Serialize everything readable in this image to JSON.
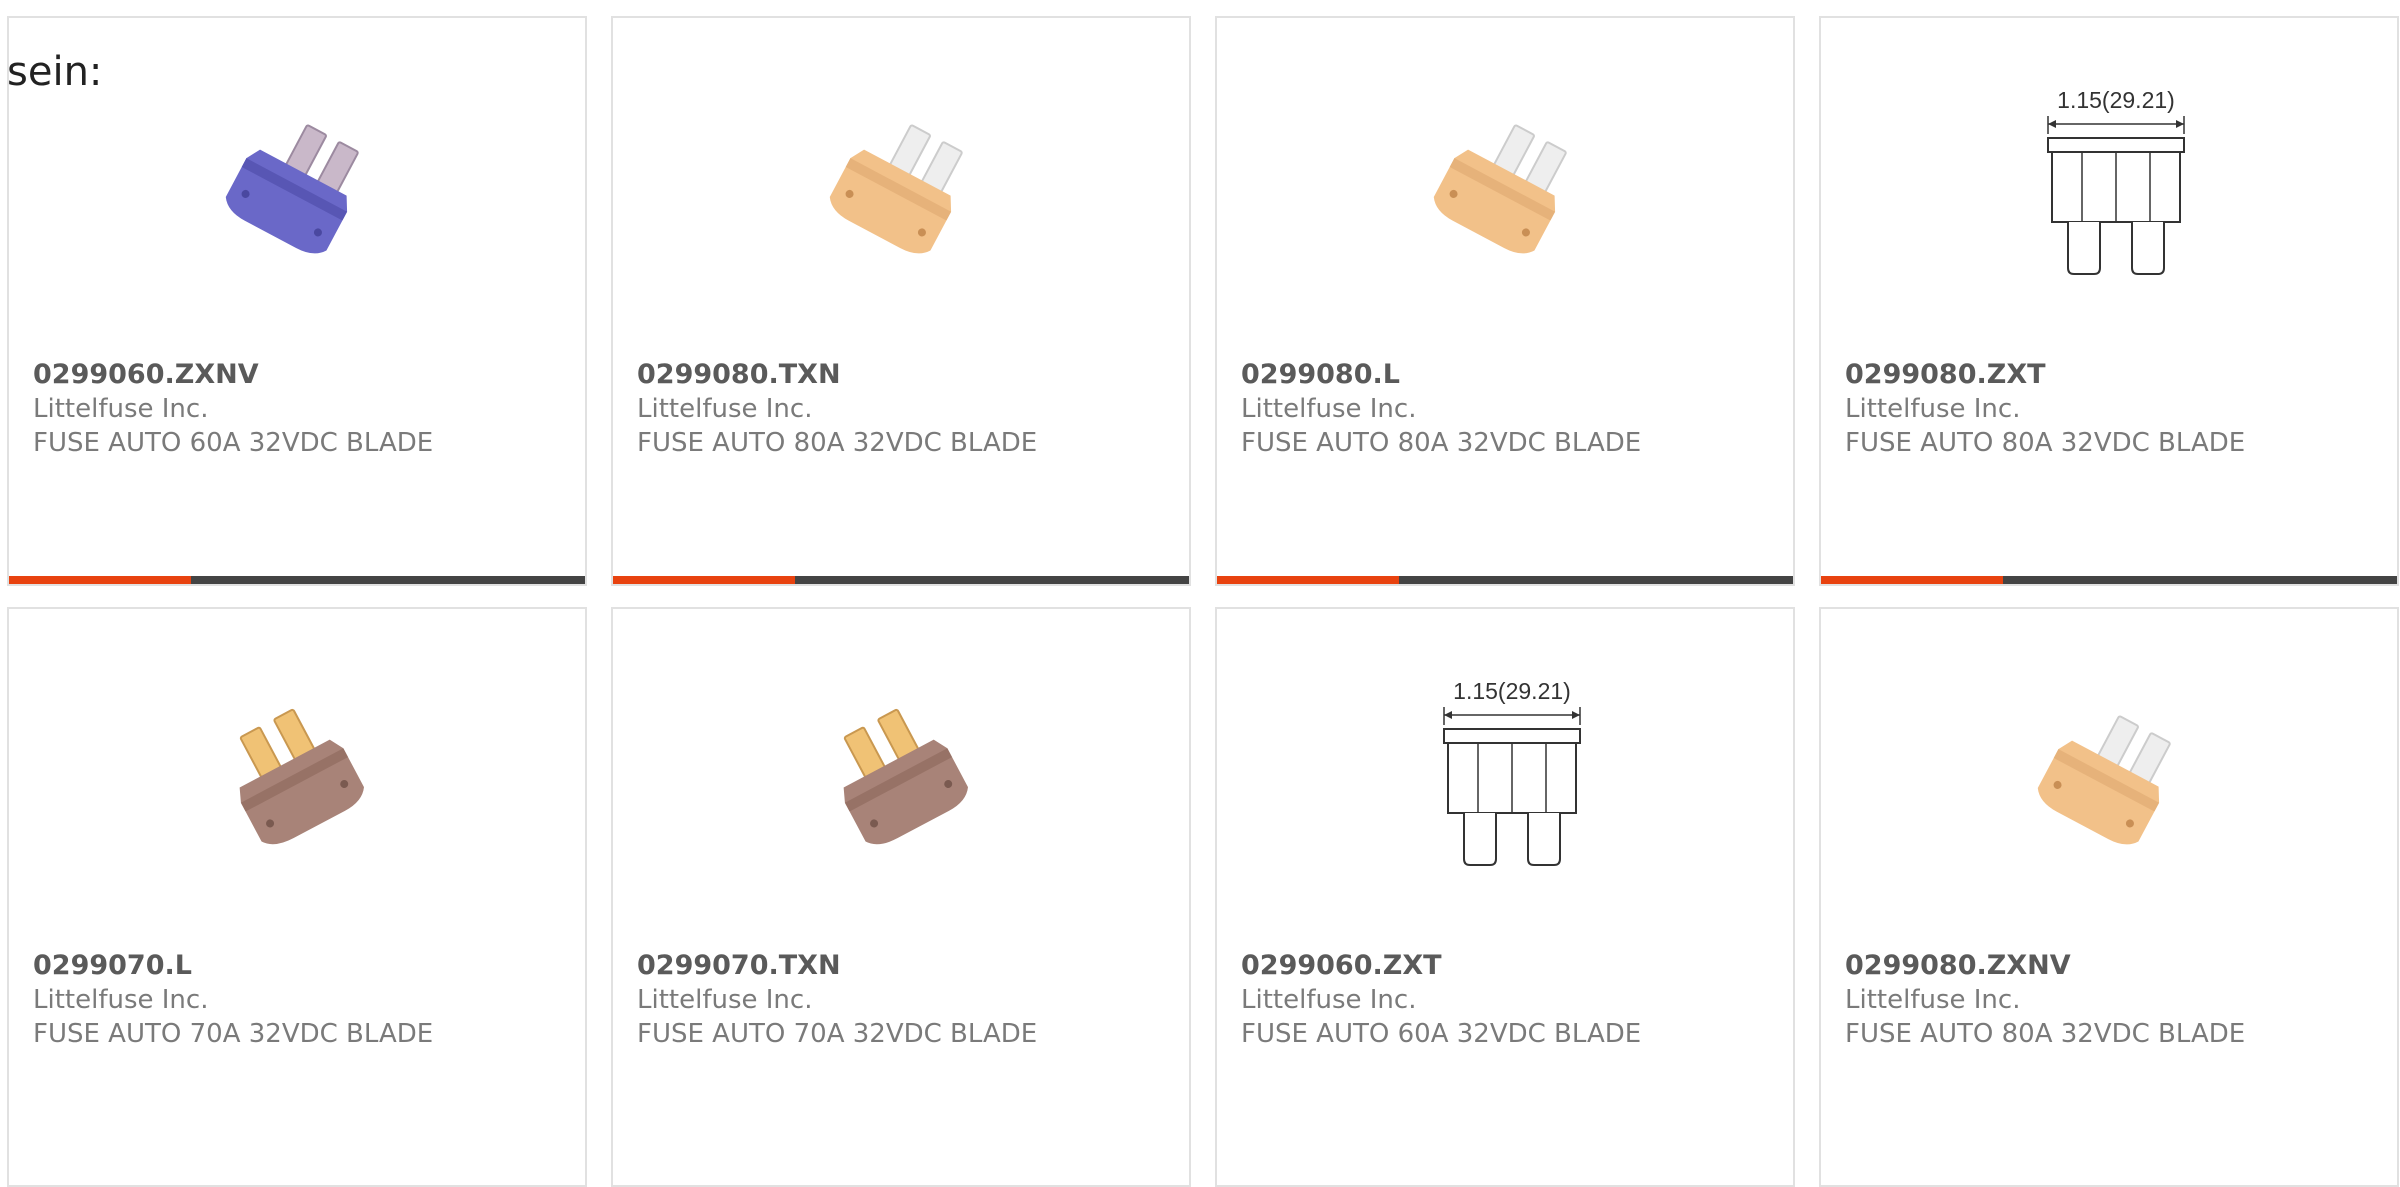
{
  "lead_text": "sein:",
  "colors": {
    "accent": "#e8420f",
    "bar": "#444444",
    "card_border": "#e1e1e1",
    "fuse_blue": "#6a68c8",
    "fuse_orange": "#f2c189",
    "fuse_brown": "#a88378"
  },
  "products": [
    {
      "part_number": "0299060.ZXNV",
      "manufacturer": "Littelfuse Inc.",
      "description": "FUSE AUTO 60A 32VDC BLADE",
      "image": "blue-blade-fuse",
      "dimension_label": ""
    },
    {
      "part_number": "0299080.TXN",
      "manufacturer": "Littelfuse Inc.",
      "description": "FUSE AUTO 80A 32VDC BLADE",
      "image": "orange-blade-fuse",
      "dimension_label": ""
    },
    {
      "part_number": "0299080.L",
      "manufacturer": "Littelfuse Inc.",
      "description": "FUSE AUTO 80A 32VDC BLADE",
      "image": "orange-blade-fuse",
      "dimension_label": ""
    },
    {
      "part_number": "0299080.ZXT",
      "manufacturer": "Littelfuse Inc.",
      "description": "FUSE AUTO 80A 32VDC BLADE",
      "image": "fuse-dimension-drawing",
      "dimension_label": "1.15(29.21)"
    },
    {
      "part_number": "0299070.L",
      "manufacturer": "Littelfuse Inc.",
      "description": "FUSE AUTO 70A 32VDC BLADE",
      "image": "brown-blade-fuse",
      "dimension_label": ""
    },
    {
      "part_number": "0299070.TXN",
      "manufacturer": "Littelfuse Inc.",
      "description": "FUSE AUTO 70A 32VDC BLADE",
      "image": "brown-blade-fuse",
      "dimension_label": ""
    },
    {
      "part_number": "0299060.ZXT",
      "manufacturer": "Littelfuse Inc.",
      "description": "FUSE AUTO 60A 32VDC BLADE",
      "image": "fuse-dimension-drawing",
      "dimension_label": "1.15(29.21)"
    },
    {
      "part_number": "0299080.ZXNV",
      "manufacturer": "Littelfuse Inc.",
      "description": "FUSE AUTO 80A 32VDC BLADE",
      "image": "orange-blade-fuse",
      "dimension_label": ""
    }
  ]
}
